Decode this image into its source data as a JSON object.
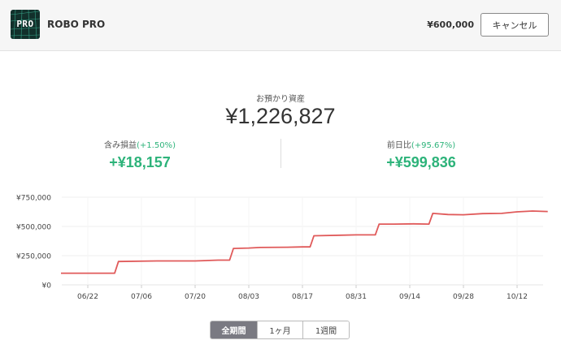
{
  "header": {
    "logo_text": "PRO",
    "app_name": "ROBO PRO",
    "amount": "¥600,000",
    "cancel_label": "キャンセル"
  },
  "summary": {
    "balance_label": "お預かり資産",
    "balance_value": "¥1,226,827",
    "unrealized": {
      "label": "含み損益",
      "pct": "(+1.50%)",
      "value": "+¥18,157"
    },
    "day_change": {
      "label": "前日比",
      "pct": "(+95.67%)",
      "value": "+¥599,836"
    }
  },
  "period_tabs": [
    {
      "label": "全期間",
      "active": true
    },
    {
      "label": "1ヶ月",
      "active": false
    },
    {
      "label": "1週間",
      "active": false
    }
  ],
  "colors": {
    "line": "#e05a5a",
    "positive": "#2db37a",
    "active_tab": "#7a7a82"
  },
  "chart_data": {
    "type": "line",
    "y_tick_labels": [
      "¥750,000",
      "¥500,000",
      "¥250,000",
      "¥0"
    ],
    "y_ticks": [
      750000,
      500000,
      250000,
      0
    ],
    "ylim": [
      0,
      750000
    ],
    "x_tick_labels": [
      "06/22",
      "07/06",
      "07/20",
      "08/03",
      "08/17",
      "08/31",
      "09/14",
      "09/28",
      "10/12"
    ],
    "grid": true,
    "series": [
      {
        "values": [
          {
            "x": "06/15",
            "y": 100000
          },
          {
            "x": "06/29",
            "y": 100000
          },
          {
            "x": "06/30",
            "y": 200000
          },
          {
            "x": "07/10",
            "y": 205000
          },
          {
            "x": "07/20",
            "y": 205000
          },
          {
            "x": "07/26",
            "y": 212000
          },
          {
            "x": "07/29",
            "y": 212000
          },
          {
            "x": "07/30",
            "y": 312000
          },
          {
            "x": "08/03",
            "y": 315000
          },
          {
            "x": "08/06",
            "y": 320000
          },
          {
            "x": "08/13",
            "y": 322000
          },
          {
            "x": "08/17",
            "y": 325000
          },
          {
            "x": "08/19",
            "y": 325000
          },
          {
            "x": "08/20",
            "y": 420000
          },
          {
            "x": "08/27",
            "y": 425000
          },
          {
            "x": "08/31",
            "y": 428000
          },
          {
            "x": "09/05",
            "y": 428000
          },
          {
            "x": "09/06",
            "y": 520000
          },
          {
            "x": "09/10",
            "y": 520000
          },
          {
            "x": "09/15",
            "y": 522000
          },
          {
            "x": "09/19",
            "y": 520000
          },
          {
            "x": "09/20",
            "y": 612000
          },
          {
            "x": "09/24",
            "y": 602000
          },
          {
            "x": "09/28",
            "y": 600000
          },
          {
            "x": "10/03",
            "y": 610000
          },
          {
            "x": "10/08",
            "y": 612000
          },
          {
            "x": "10/12",
            "y": 625000
          },
          {
            "x": "10/16",
            "y": 632000
          },
          {
            "x": "10/20",
            "y": 628000
          }
        ]
      }
    ]
  }
}
